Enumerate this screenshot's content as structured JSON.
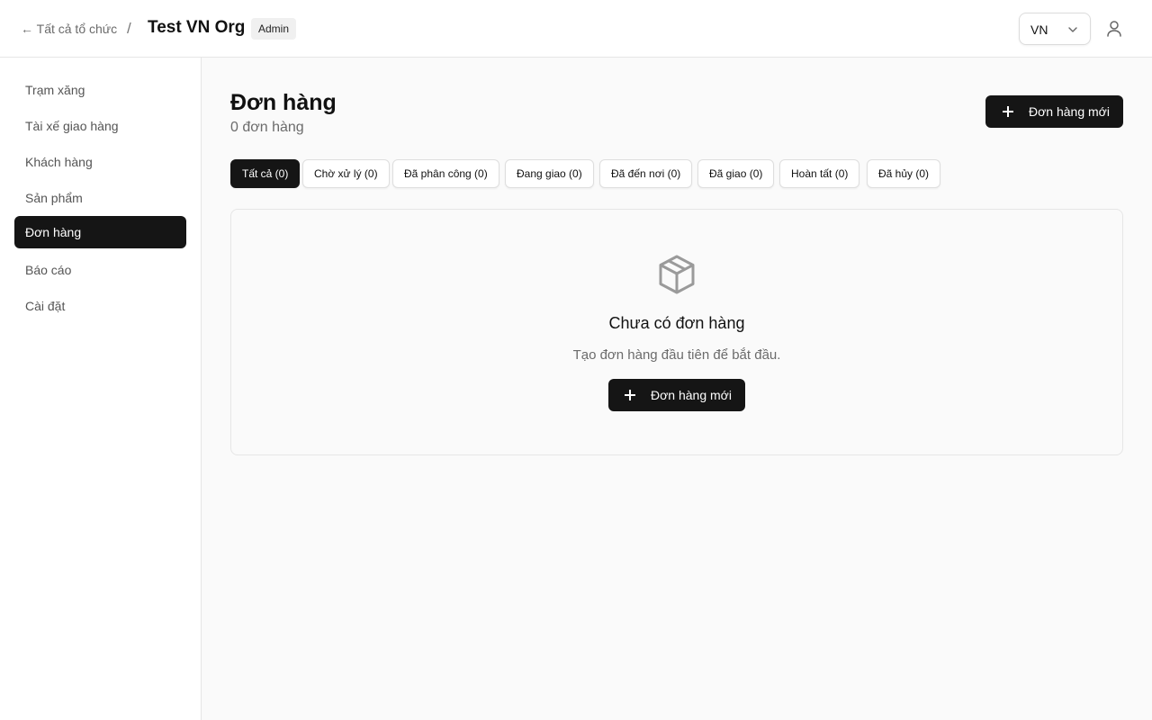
{
  "header": {
    "back_label": "← Tất cả tổ chức",
    "separator": "/",
    "org_name": "Test VN Org",
    "role_badge": "Admin",
    "language": "VN"
  },
  "sidebar": {
    "items": [
      {
        "label": "Trạm xăng"
      },
      {
        "label": "Tài xế giao hàng"
      },
      {
        "label": "Khách hàng"
      },
      {
        "label": "Sản phẩm"
      },
      {
        "label": "Đơn hàng",
        "active": true
      },
      {
        "label": "Báo cáo"
      },
      {
        "label": "Cài đặt"
      }
    ]
  },
  "main": {
    "title": "Đơn hàng",
    "subtitle": "0 đơn hàng",
    "new_order_label": "Đơn hàng mới",
    "tabs": [
      {
        "label": "Tất cả (0)",
        "active": true
      },
      {
        "label": "Chờ xử lý (0)"
      },
      {
        "label": "Đã phân công (0)"
      },
      {
        "label": "Đang giao (0)"
      },
      {
        "label": "Đã đến nơi (0)"
      },
      {
        "label": "Đã giao (0)"
      },
      {
        "label": "Hoàn tất (0)"
      },
      {
        "label": "Đã hủy (0)"
      }
    ],
    "empty_state": {
      "icon": "package-icon",
      "title": "Chưa có đơn hàng",
      "description": "Tạo đơn hàng đầu tiên để bắt đầu.",
      "button_label": "Đơn hàng mới"
    }
  },
  "colors": {
    "primary": "#151515",
    "background": "#fafafa",
    "border": "#e6e6e6",
    "muted_text": "#6b6b6b"
  }
}
